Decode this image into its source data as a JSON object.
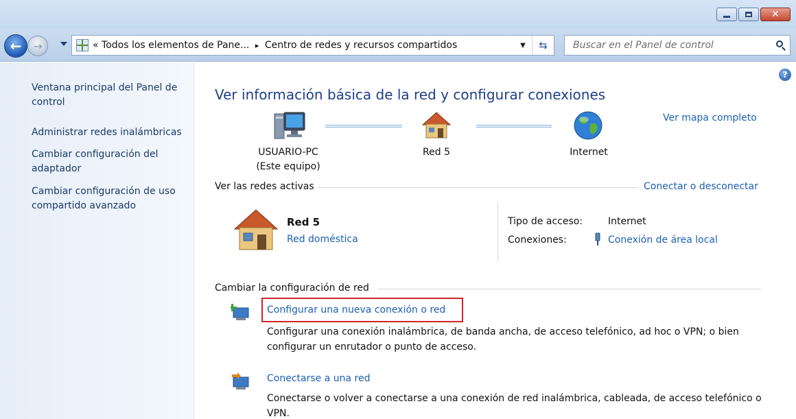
{
  "window": {
    "minimize_icon": "minimize-icon",
    "maximize_icon": "maximize-icon",
    "close_icon": "close-icon"
  },
  "navigation": {
    "back_icon": "back-arrow-icon",
    "forward_icon": "forward-arrow-icon",
    "breadcrumb_prefix": "«",
    "breadcrumb_part1": "Todos los elementos de Pane...",
    "breadcrumb_sep": "▸",
    "breadcrumb_part2": "Centro de redes y recursos compartidos",
    "refresh_icon": "refresh-icon",
    "search_placeholder": "Buscar en el Panel de control"
  },
  "sidebar": {
    "items": [
      {
        "label": "Ventana principal del Panel de control"
      },
      {
        "label": "Administrar redes inalámbricas"
      },
      {
        "label": "Cambiar configuración del adaptador"
      },
      {
        "label": "Cambiar configuración de uso compartido avanzado"
      }
    ]
  },
  "main": {
    "title": "Ver información básica de la red y configurar conexiones",
    "map_link": "Ver mapa completo",
    "nodes": [
      {
        "label_line1": "USUARIO-PC",
        "label_line2": "(Este equipo)",
        "icon": "computer-icon"
      },
      {
        "label_line1": "Red 5",
        "icon": "house-icon"
      },
      {
        "label_line1": "Internet",
        "icon": "globe-icon"
      }
    ],
    "active_networks": {
      "heading": "Ver las redes activas",
      "connect_link": "Conectar o desconectar",
      "network_name": "Red 5",
      "network_type": "Red doméstica",
      "access_type_label": "Tipo de acceso:",
      "access_type_value": "Internet",
      "connections_label": "Conexiones:",
      "connections_value": "Conexión de área local"
    },
    "change_settings": {
      "heading": "Cambiar la configuración de red",
      "tasks": [
        {
          "link": "Configurar una nueva conexión o red",
          "description": "Configurar una conexión inalámbrica, de banda ancha, de acceso telefónico, ad hoc o VPN; o bien configurar un enrutador o punto de acceso."
        },
        {
          "link": "Conectarse a una red",
          "description": "Conectarse o volver a conectarse a una conexión de red inalámbrica, cableada, de acceso telefónico o VPN."
        }
      ]
    }
  },
  "colors": {
    "link": "#1c5fb3",
    "title": "#1e3e8a",
    "highlight": "#d1232a"
  }
}
